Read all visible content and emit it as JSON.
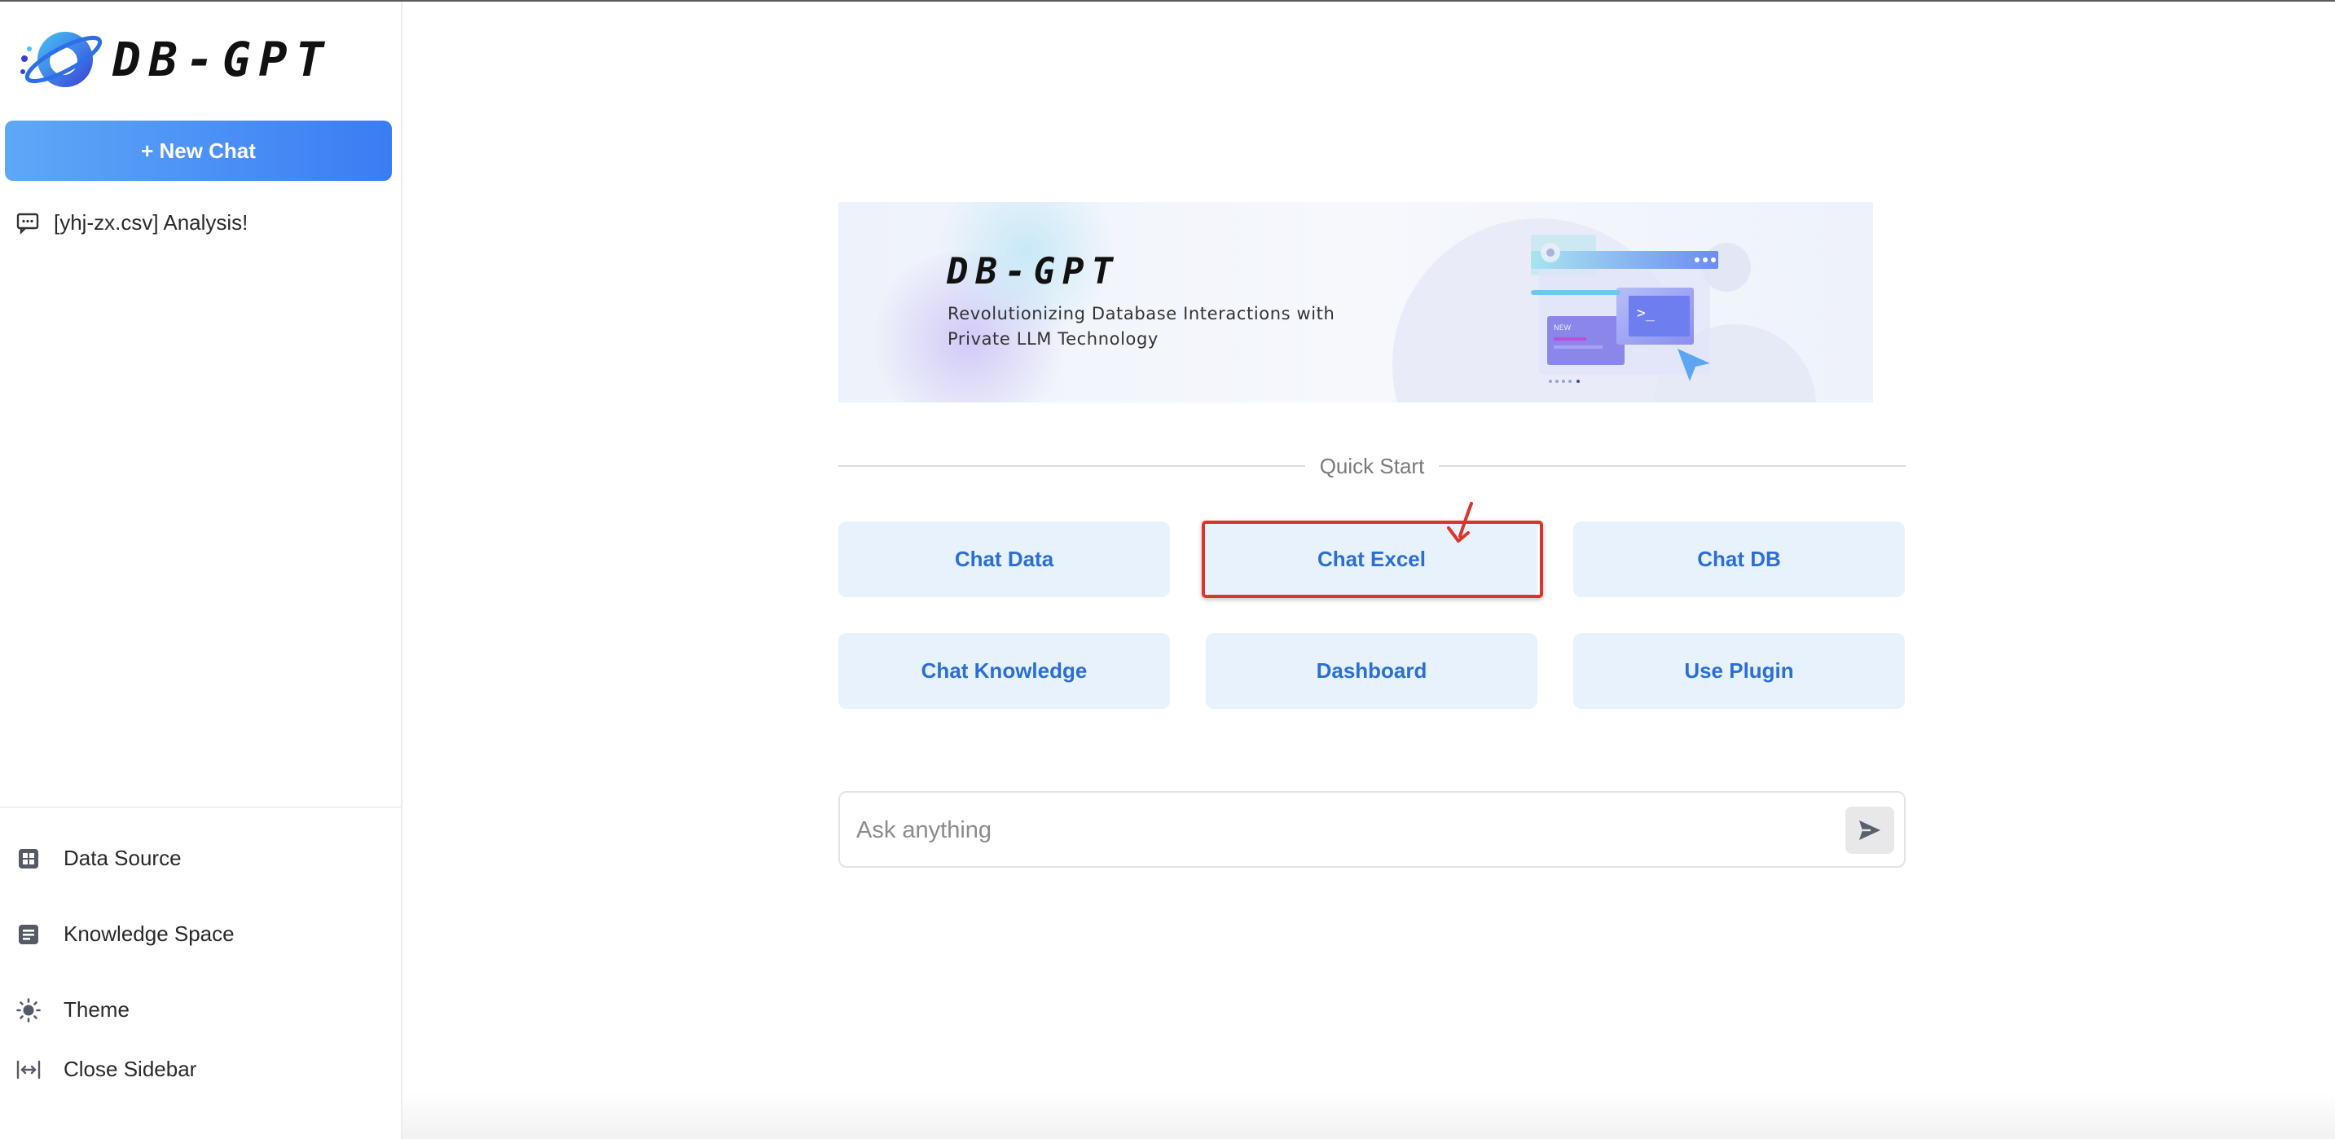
{
  "app": {
    "logo_text": "DB-GPT"
  },
  "sidebar": {
    "new_chat_label": "+ New Chat",
    "history": [
      {
        "label": "[yhj-zx.csv] Analysis!"
      }
    ],
    "menu": [
      {
        "label": "Data Source",
        "icon": "grid-icon"
      },
      {
        "label": "Knowledge Space",
        "icon": "document-icon"
      },
      {
        "label": "Theme",
        "icon": "sun-icon"
      },
      {
        "label": "Close Sidebar",
        "icon": "collapse-icon"
      }
    ]
  },
  "banner": {
    "logo_text": "DB-GPT",
    "tagline_line1": "Revolutionizing Database Interactions with",
    "tagline_line2": "Private LLM Technology"
  },
  "quick_start": {
    "label": "Quick Start",
    "buttons": [
      {
        "label": "Chat Data"
      },
      {
        "label": "Chat Excel"
      },
      {
        "label": "Chat DB"
      },
      {
        "label": "Chat Knowledge"
      },
      {
        "label": "Dashboard"
      },
      {
        "label": "Use Plugin"
      }
    ],
    "highlighted": "Chat Excel"
  },
  "input": {
    "placeholder": "Ask anything",
    "value": ""
  },
  "colors": {
    "accent": "#3b7cf4",
    "button_bg": "#e7f2fd",
    "button_text": "#2b6fd6",
    "highlight": "#d9352b"
  }
}
